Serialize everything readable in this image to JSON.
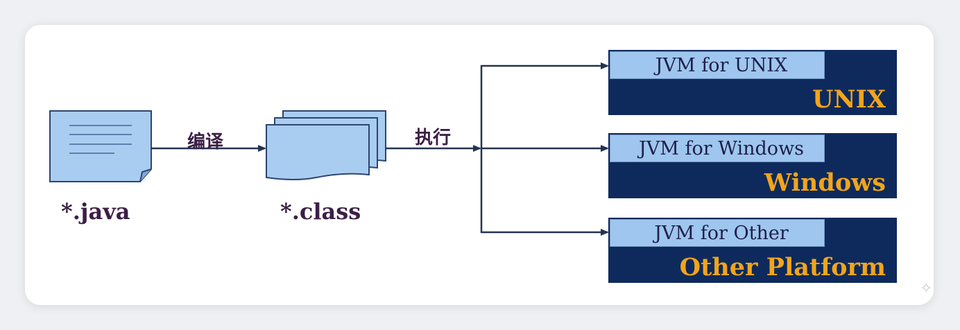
{
  "source": {
    "label": "*.java",
    "icon": "document-icon"
  },
  "compile_step": {
    "label": "编译"
  },
  "bytecode": {
    "label": "*.class",
    "icon": "stacked-documents-icon"
  },
  "execute_step": {
    "label": "执行"
  },
  "platforms": [
    {
      "jvm_label": "JVM for UNIX",
      "os_label": "UNIX"
    },
    {
      "jvm_label": "JVM for Windows",
      "os_label": "Windows"
    },
    {
      "jvm_label": "JVM for Other",
      "os_label": "Other Platform"
    }
  ],
  "colors": {
    "document_fill": "#a9cdf0",
    "platform_box": "#0e2a5c",
    "jvm_tab": "#9ec6ee",
    "os_text": "#f2a51b",
    "label_text": "#3b1f45",
    "arrow": "#24344f"
  }
}
